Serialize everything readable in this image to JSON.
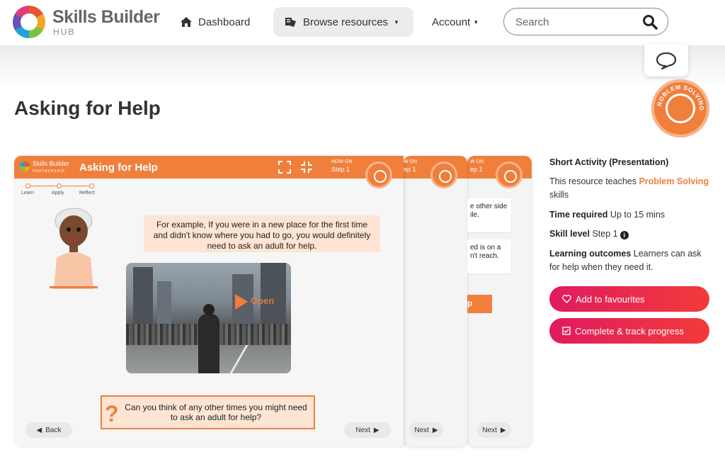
{
  "header": {
    "logo_name": "Skills Builder",
    "logo_sub": "HUB",
    "nav": {
      "dashboard": "Dashboard",
      "browse": "Browse resources",
      "account": "Account"
    },
    "search_placeholder": "Search"
  },
  "badge": {
    "text": "PROBLEM SOLVING"
  },
  "page": {
    "title": "Asking for Help"
  },
  "slide": {
    "brand": "Skills Builder",
    "brand_sub": "PARTNERSHIP",
    "title": "Asking for Help",
    "now_on": "NOW ON",
    "step": "Step 1",
    "progress": [
      "Learn",
      "Apply",
      "Reflect"
    ],
    "speech": "For example, If you were in a new place for the first time and didn't know where you had to go, you would definitely need to ask an adult for help.",
    "video_label": "Open",
    "question": "Can you think of any other times you might need to ask an adult for help?",
    "back_label": "Back",
    "next_label": "Next"
  },
  "back_slides": {
    "step_partial": "ep 1",
    "now_partial": "W ON",
    "card1": "e other side\nile.",
    "card2": "ed is on a\nn't reach.",
    "orange_partial": "p"
  },
  "info": {
    "activity_type": "Short Activity (Presentation)",
    "teaches_prefix": "This resource teaches ",
    "teaches_skill": "Problem Solving",
    "teaches_suffix": " skills",
    "time_label": "Time required",
    "time_value": "Up to 15 mins",
    "level_label": "Skill level",
    "level_value": "Step 1",
    "outcomes_label": "Learning outcomes",
    "outcomes_value": "Learners can ask for help when they need it."
  },
  "actions": {
    "favourites": "Add to favourites",
    "track": "Complete & track progress"
  },
  "colors": {
    "accent": "#f07f3c",
    "cta": "#e8254d"
  }
}
